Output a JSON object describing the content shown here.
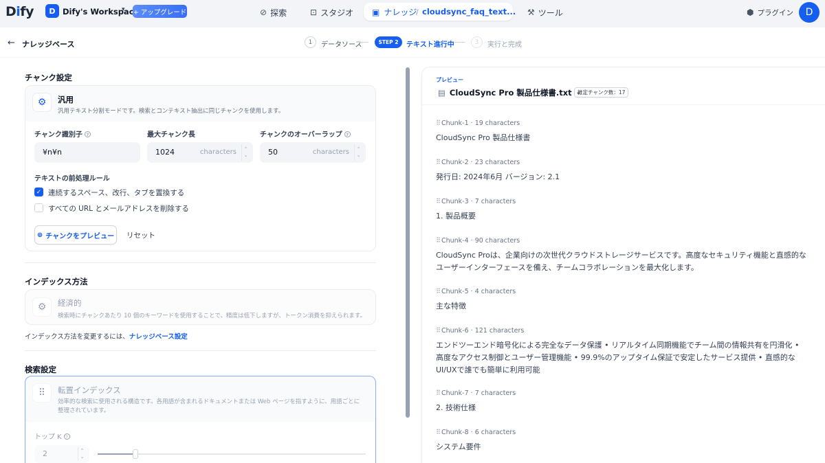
{
  "topnav": {
    "logo": "Dify",
    "workspace_avatar": "D",
    "workspace_name": "Dify's Workspace",
    "upgrade_label": "+ アップグレード",
    "explore_label": "探索",
    "studio_label": "スタジオ",
    "knowledge_label": "ナレッジ",
    "current_doc": "cloudsync_faq_text...",
    "tools_label": "ツール",
    "plugins_label": "プラグイン",
    "user_avatar": "D"
  },
  "header": {
    "back_title": "ナレッジベース",
    "steps": [
      {
        "num": "1",
        "label": "データソース"
      },
      {
        "num": "STEP 2",
        "label": "テキスト進行中"
      },
      {
        "num": "3",
        "label": "実行と完成"
      }
    ]
  },
  "chunk_settings": {
    "title": "チャンク設定",
    "mode_title": "汎用",
    "mode_desc": "汎用テキスト分割モードです。検索とコンテキスト抽出に同じチャンクを使用します。",
    "delimiter_label": "チャンク識別子",
    "delimiter_value": "¥n¥n",
    "max_length_label": "最大チャンク長",
    "max_length_value": "1024",
    "max_length_unit": "characters",
    "overlap_label": "チャンクのオーバーラップ",
    "overlap_value": "50",
    "overlap_unit": "characters",
    "preprocess_title": "テキストの前処理ルール",
    "rule1": "連続するスペース、改行、タブを置換する",
    "rule1_checked": true,
    "rule2": "すべての URL とメールアドレスを削除する",
    "rule2_checked": false,
    "preview_button": "チャンクをプレビュー",
    "reset_button": "リセット"
  },
  "index_method": {
    "title": "インデックス方法",
    "option_title": "経済的",
    "option_desc": "検索時にチャンクあたり 10 個のキーワードを使用することで、精度は低下しますが、トークン消費を抑えられます。",
    "note": "インデックス方法を変更するには、",
    "note_link": "ナレッジベース設定"
  },
  "retrieval": {
    "title": "検索設定",
    "option_title": "転置インデックス",
    "option_desc_line1": "効率的な検索に使用される構造です。各用語が含まれるドキュメントまたは Web ページを指すように、用語ごとに",
    "option_desc_line2": "整理されています。",
    "topk_label": "トップ K",
    "topk_value": "2",
    "topk_level": 0.14
  },
  "preview": {
    "label": "プレビュー",
    "file_name": "CloudSync Pro 製品仕様書.txt",
    "estimate_badge": "推定チャンク数：17",
    "chunks": [
      {
        "id": "Chunk-1",
        "chars": "19 characters",
        "text": "CloudSync Pro 製品仕様書"
      },
      {
        "id": "Chunk-2",
        "chars": "23 characters",
        "text": "発行日: 2024年6月 バージョン: 2.1"
      },
      {
        "id": "Chunk-3",
        "chars": "7 characters",
        "text": "1. 製品概要"
      },
      {
        "id": "Chunk-4",
        "chars": "90 characters",
        "text": "CloudSync Proは、企業向けの次世代クラウドストレージサービスです。高度なセキュリティ機能と直感的なユーザーインターフェースを備え、チームコラボレーションを最大化します。"
      },
      {
        "id": "Chunk-5",
        "chars": "4 characters",
        "text": "主な特徴"
      },
      {
        "id": "Chunk-6",
        "chars": "121 characters",
        "text": "エンドツーエンド暗号化による完全なデータ保護 • リアルタイム同期機能でチーム間の情報共有を円滑化 • 高度なアクセス制御とユーザー管理機能 • 99.9%のアップタイム保証で安定したサービス提供 • 直感的なUI/UXで誰でも簡単に利用可能"
      },
      {
        "id": "Chunk-7",
        "chars": "7 characters",
        "text": "2. 技術仕様"
      },
      {
        "id": "Chunk-8",
        "chars": "6 characters",
        "text": "システム要件"
      }
    ]
  },
  "colors": {
    "accent": "#155eef",
    "nav_bg": "#f2f4f7",
    "muted": "#98a2b3"
  }
}
